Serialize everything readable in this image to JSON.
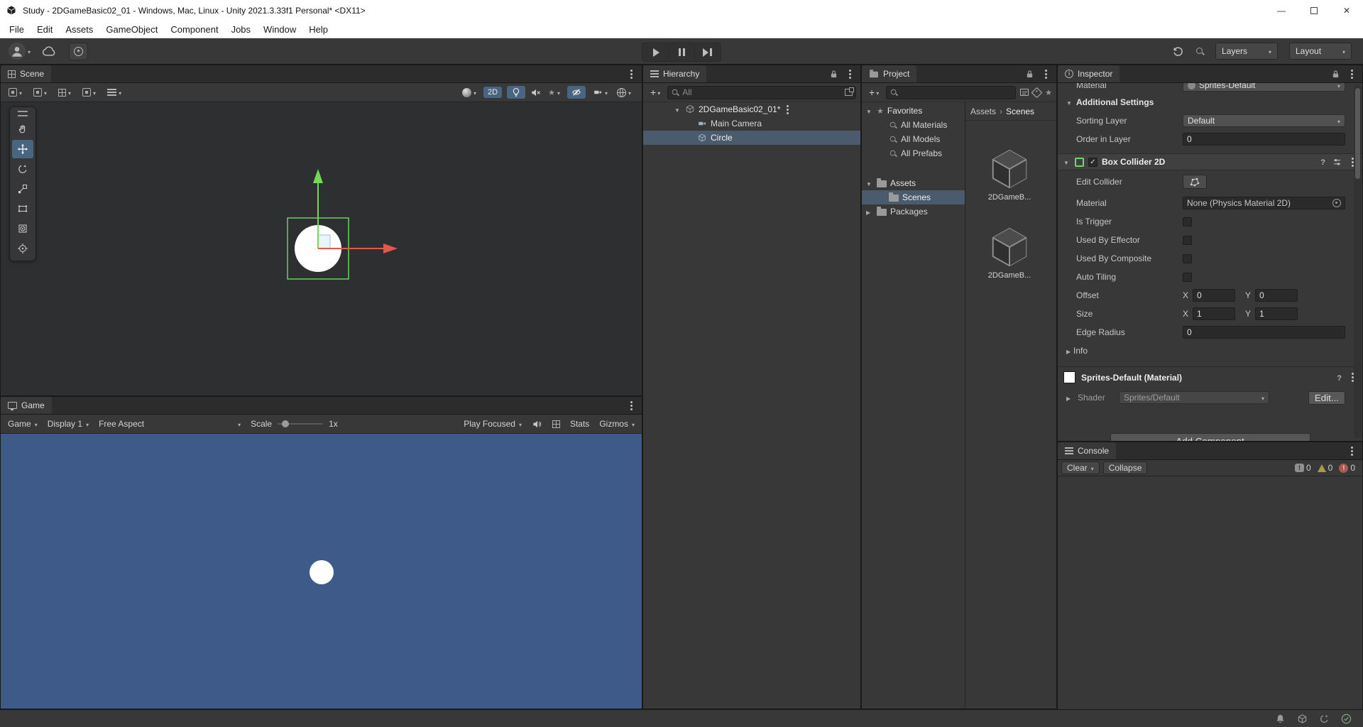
{
  "titlebar": {
    "title": "Study - 2DGameBasic02_01 - Windows, Mac, Linux - Unity 2021.3.33f1 Personal* <DX11>",
    "minimize": "—",
    "close": "✕"
  },
  "menubar": {
    "items": [
      "File",
      "Edit",
      "Assets",
      "GameObject",
      "Component",
      "Jobs",
      "Window",
      "Help"
    ]
  },
  "toolbar": {
    "layers": "Layers",
    "layout": "Layout"
  },
  "scene": {
    "tab": "Scene",
    "toggle_2d": "2D"
  },
  "game": {
    "tab": "Game",
    "view_menu": "Game",
    "display": "Display 1",
    "aspect": "Free Aspect",
    "scale_label": "Scale",
    "scale_value": "1x",
    "play_focused": "Play Focused",
    "stats": "Stats",
    "gizmos": "Gizmos"
  },
  "hierarchy": {
    "tab": "Hierarchy",
    "search_placeholder": "All",
    "root": "2DGameBasic02_01*",
    "items": [
      {
        "label": "Main Camera"
      },
      {
        "label": "Circle"
      }
    ]
  },
  "project": {
    "tab": "Project",
    "favorites": "Favorites",
    "favorite_items": [
      "All Materials",
      "All Models",
      "All Prefabs"
    ],
    "assets": "Assets",
    "scenes": "Scenes",
    "packages": "Packages",
    "breadcrumb_root": "Assets",
    "breadcrumb_current": "Scenes",
    "assets_grid": [
      {
        "label": "2DGameB..."
      },
      {
        "label": "2DGameB..."
      }
    ]
  },
  "inspector": {
    "tab": "Inspector",
    "clipped_label": "Material",
    "clipped_value": "Sprites-Default",
    "additional_settings": "Additional Settings",
    "sorting_layer": "Sorting Layer",
    "sorting_layer_value": "Default",
    "order_in_layer": "Order in Layer",
    "order_in_layer_value": "0",
    "collider_title": "Box Collider 2D",
    "edit_collider": "Edit Collider",
    "material": "Material",
    "material_value": "None (Physics Material 2D)",
    "is_trigger": "Is Trigger",
    "used_by_effector": "Used By Effector",
    "used_by_composite": "Used By Composite",
    "auto_tiling": "Auto Tiling",
    "offset": "Offset",
    "x_label": "X",
    "y_label": "Y",
    "offset_x": "0",
    "offset_y": "0",
    "size": "Size",
    "size_x": "1",
    "size_y": "1",
    "edge_radius": "Edge Radius",
    "edge_radius_value": "0",
    "info": "Info",
    "material_section_title": "Sprites-Default (Material)",
    "shader": "Shader",
    "shader_value": "Sprites/Default",
    "edit_button": "Edit...",
    "add_component": "Add Component"
  },
  "console": {
    "tab": "Console",
    "clear": "Clear",
    "collapse": "Collapse",
    "info_count": "0",
    "warning_count": "0",
    "error_count": "0"
  },
  "colors": {
    "game_background": "#3d5a88",
    "selection": "#4a5b6e",
    "active_toggle_blue": "#4a6582",
    "collider_green": "#6ddb64",
    "axis_x_red": "#e4574b",
    "axis_y_green": "#77d655",
    "sprite_white": "#ffffff"
  },
  "icons": {
    "caret": "▾",
    "fold_open": "▼",
    "fold_closed": "▶",
    "kebab": "vertical-dots",
    "search": "magnifier",
    "favorites_star": "★",
    "breadcrumb_separator": "›"
  }
}
